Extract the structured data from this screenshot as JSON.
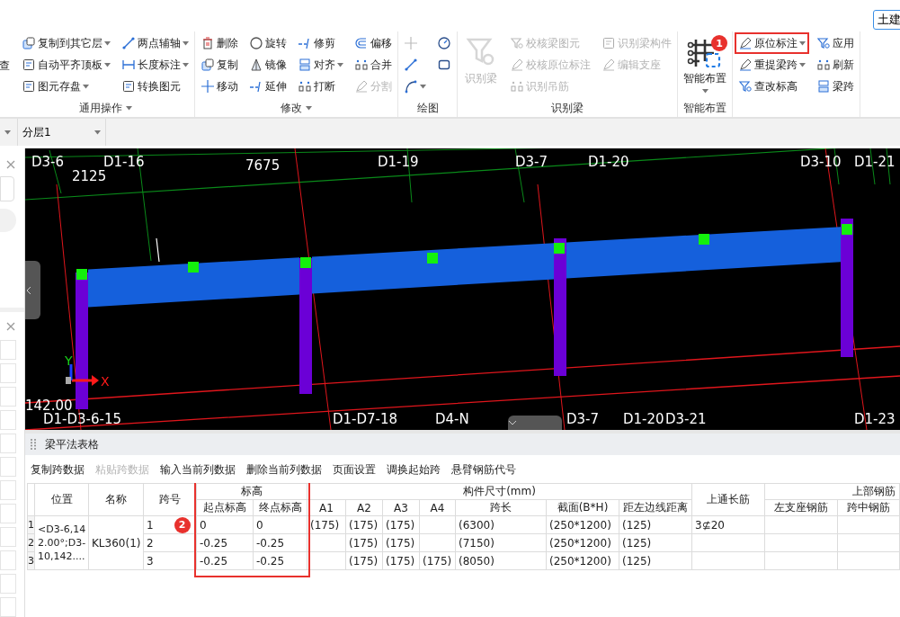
{
  "top_bar": {
    "mode_button": "土建"
  },
  "ribbon": {
    "clipped_left": {
      "label": "查"
    },
    "groups": [
      {
        "title": "通用操作",
        "title_dropdown": true,
        "columns": [
          [
            {
              "label": "复制到其它层",
              "dropdown": true,
              "disabled": false,
              "highlighted": false
            },
            {
              "label": "自动平齐顶板",
              "dropdown": true,
              "disabled": false,
              "highlighted": false
            },
            {
              "label": "图元存盘",
              "dropdown": true,
              "disabled": false,
              "highlighted": false
            }
          ],
          [
            {
              "label": "两点辅轴",
              "dropdown": true,
              "disabled": false,
              "highlighted": false
            },
            {
              "label": "长度标注",
              "dropdown": true,
              "disabled": false,
              "highlighted": false
            },
            {
              "label": "转换图元",
              "dropdown": false,
              "disabled": false,
              "highlighted": false
            }
          ]
        ]
      },
      {
        "title": "修改",
        "title_dropdown": true,
        "columns": [
          [
            {
              "label": "删除",
              "dropdown": false,
              "disabled": false,
              "highlighted": false
            },
            {
              "label": "复制",
              "dropdown": false,
              "disabled": false,
              "highlighted": false
            },
            {
              "label": "移动",
              "dropdown": false,
              "disabled": false,
              "highlighted": false
            }
          ],
          [
            {
              "label": "旋转",
              "dropdown": false,
              "disabled": false,
              "highlighted": false
            },
            {
              "label": "镜像",
              "dropdown": false,
              "disabled": false,
              "highlighted": false
            },
            {
              "label": "延伸",
              "dropdown": false,
              "disabled": false,
              "highlighted": false
            }
          ],
          [
            {
              "label": "修剪",
              "dropdown": false,
              "disabled": false,
              "highlighted": false
            },
            {
              "label": "对齐",
              "dropdown": true,
              "disabled": false,
              "highlighted": false
            },
            {
              "label": "打断",
              "dropdown": false,
              "disabled": false,
              "highlighted": false
            }
          ],
          [
            {
              "label": "偏移",
              "dropdown": false,
              "disabled": false,
              "highlighted": false
            },
            {
              "label": "合并",
              "dropdown": false,
              "disabled": false,
              "highlighted": false
            },
            {
              "label": "分割",
              "dropdown": false,
              "disabled": true,
              "highlighted": false
            }
          ]
        ]
      },
      {
        "title": "绘图",
        "title_dropdown": false,
        "columns": [
          [
            {
              "dropdown": false,
              "disabled": true,
              "highlighted": false
            },
            {
              "dropdown": false,
              "disabled": false,
              "highlighted": false
            },
            {
              "dropdown": true,
              "disabled": false,
              "highlighted": false
            }
          ],
          [
            {
              "dropdown": false,
              "disabled": false,
              "highlighted": false
            },
            {
              "dropdown": false,
              "disabled": false,
              "highlighted": false
            }
          ]
        ]
      },
      {
        "title": "识别梁",
        "title_dropdown": false,
        "big": {
          "label": "识别梁",
          "dropdown": false,
          "disabled": true
        },
        "columns": [
          [
            {
              "label": "校核梁图元",
              "dropdown": false,
              "disabled": true,
              "highlighted": false
            },
            {
              "label": "校核原位标注",
              "dropdown": false,
              "disabled": true,
              "highlighted": false
            },
            {
              "label": "识别吊筋",
              "dropdown": false,
              "disabled": true,
              "highlighted": false
            }
          ],
          [
            {
              "label": "识别梁构件",
              "dropdown": false,
              "disabled": true,
              "highlighted": false
            },
            {
              "label": "编辑支座",
              "dropdown": false,
              "disabled": true,
              "highlighted": false
            }
          ]
        ]
      },
      {
        "title": "智能布置",
        "title_dropdown": false,
        "big": {
          "label": "智能布置",
          "dropdown": true,
          "disabled": false
        }
      },
      {
        "columns": [
          [
            {
              "label": "原位标注",
              "dropdown": true,
              "disabled": false,
              "highlighted": true,
              "badge": "1"
            },
            {
              "label": "重提梁跨",
              "dropdown": true,
              "disabled": false,
              "highlighted": false
            },
            {
              "label": "查改标高",
              "dropdown": false,
              "disabled": false,
              "highlighted": false
            }
          ],
          [
            {
              "label": "应用",
              "dropdown": false,
              "disabled": false,
              "highlighted": false
            },
            {
              "label": "刷新",
              "dropdown": false,
              "disabled": false,
              "highlighted": false
            },
            {
              "label": "梁跨",
              "dropdown": false,
              "disabled": false,
              "highlighted": false
            }
          ]
        ]
      }
    ]
  },
  "layer_bar": {
    "layer": "分层1"
  },
  "canvas": {
    "labels": [
      "D3-6",
      "D1-16",
      "2125",
      "7675",
      "D1-19",
      "D3-7",
      "D1-20",
      "D3-10",
      "D1-21",
      "142.00",
      "D1-D3-6-15",
      "D1-D7-18",
      "D4-N",
      "D3-7",
      "D1-20",
      "D3-21",
      "D1-23"
    ],
    "axis_labels": [
      "X",
      "Y"
    ]
  },
  "beam_table": {
    "title": "梁平法表格",
    "toolbar": [
      {
        "label": "复制跨数据",
        "disabled": false
      },
      {
        "label": "粘贴跨数据",
        "disabled": true
      },
      {
        "label": "输入当前列数据",
        "disabled": false
      },
      {
        "label": "删除当前列数据",
        "disabled": false
      },
      {
        "label": "页面设置",
        "disabled": false
      },
      {
        "label": "调换起始跨",
        "disabled": false
      },
      {
        "label": "悬臂钢筋代号",
        "disabled": false
      }
    ],
    "header_rows": [
      [
        {
          "label": "位置",
          "rowspan": 2
        },
        {
          "label": "名称",
          "rowspan": 2
        },
        {
          "label": "跨号",
          "rowspan": 2
        },
        {
          "label": "标高",
          "colspan": 2,
          "highlighted": true
        },
        {
          "label": "构件尺寸(mm)",
          "colspan": 7,
          "highlighted": false
        },
        {
          "label": "上通长筋",
          "rowspan": 2
        },
        {
          "label": "上部钢筋",
          "colspan": 2,
          "highlighted": false
        }
      ],
      [
        {
          "label": "起点标高"
        },
        {
          "label": "终点标高"
        },
        {
          "label": "A1"
        },
        {
          "label": "A2"
        },
        {
          "label": "A3"
        },
        {
          "label": "A4"
        },
        {
          "label": "跨长"
        },
        {
          "label": "截面(B*H)"
        },
        {
          "label": "距左边线距离"
        },
        {
          "label": "左支座钢筋"
        },
        {
          "label": "跨中钢筋"
        }
      ]
    ],
    "highlight_badge": "2",
    "rows": [
      {
        "number": "1",
        "cells": [
          {
            "text": "<D3-6,142.00°;D3-10,142....",
            "rowspan": 3
          },
          {
            "text": "KL360(1)",
            "rowspan": 3
          },
          "1",
          "0",
          "0",
          "(175)",
          "(175)",
          "(175)",
          null,
          "(6300)",
          "(250*1200)",
          "(125)",
          "3⊈20",
          null,
          null
        ]
      },
      {
        "number": "2",
        "cells": [
          "2",
          "-0.25",
          "-0.25",
          null,
          "(175)",
          "(175)",
          null,
          "(7150)",
          "(250*1200)",
          "(125)",
          null,
          null,
          null
        ]
      },
      {
        "number": "3",
        "cells": [
          "3",
          "-0.25",
          "-0.25",
          null,
          "(175)",
          "(175)",
          "(175)",
          "(8050)",
          "(250*1200)",
          "(125)",
          null,
          null,
          null
        ]
      }
    ]
  }
}
